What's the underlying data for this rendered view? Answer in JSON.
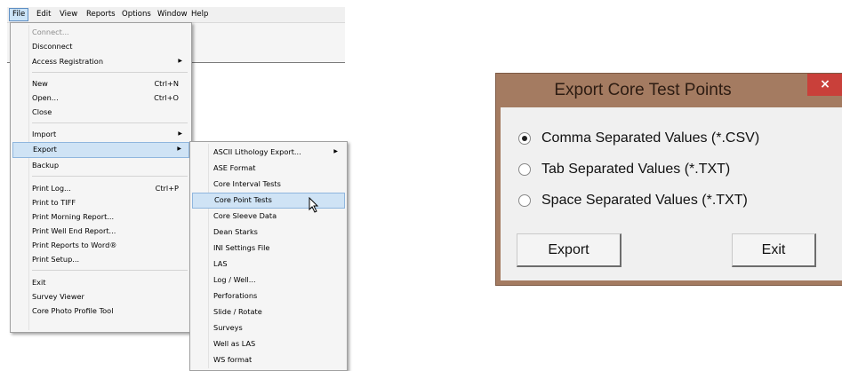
{
  "menubar": {
    "items": [
      "File",
      "Edit",
      "View",
      "Reports",
      "Options",
      "Window",
      "Help"
    ]
  },
  "file_menu": {
    "items": [
      {
        "label": "Connect...",
        "disabled": true
      },
      {
        "label": "Disconnect"
      },
      {
        "label": "Access Registration",
        "submenu": true
      },
      {
        "label": "New",
        "shortcut": "Ctrl+N"
      },
      {
        "label": "Open...",
        "shortcut": "Ctrl+O"
      },
      {
        "label": "Close"
      },
      {
        "label": "Import",
        "submenu": true
      },
      {
        "label": "Export",
        "submenu": true,
        "highlighted": true
      },
      {
        "label": "Backup"
      },
      {
        "label": "Print Log...",
        "shortcut": "Ctrl+P"
      },
      {
        "label": "Print to TIFF"
      },
      {
        "label": "Print Morning Report..."
      },
      {
        "label": "Print Well End Report..."
      },
      {
        "label": "Print Reports to Word®"
      },
      {
        "label": "Print Setup..."
      },
      {
        "label": "Exit"
      },
      {
        "label": "Survey Viewer"
      },
      {
        "label": "Core Photo Profile Tool"
      }
    ]
  },
  "export_menu": {
    "items": [
      {
        "label": "ASCII Lithology Export...",
        "submenu": true
      },
      {
        "label": "ASE Format"
      },
      {
        "label": "Core Interval Tests"
      },
      {
        "label": "Core Point Tests",
        "highlighted": true
      },
      {
        "label": "Core Sleeve Data"
      },
      {
        "label": "Dean Starks"
      },
      {
        "label": "INI Settings File"
      },
      {
        "label": "LAS"
      },
      {
        "label": "Log / Well..."
      },
      {
        "label": "Perforations"
      },
      {
        "label": "Slide / Rotate"
      },
      {
        "label": "Surveys"
      },
      {
        "label": "Well as LAS"
      },
      {
        "label": "WS format"
      }
    ]
  },
  "dialog": {
    "title": "Export Core Test Points",
    "close_glyph": "×",
    "options": [
      {
        "label": "Comma Separated Values (*.CSV)",
        "selected": true
      },
      {
        "label": "Tab Separated Values (*.TXT)",
        "selected": false
      },
      {
        "label": "Space Separated Values (*.TXT)",
        "selected": false
      }
    ],
    "export_label": "Export",
    "exit_label": "Exit"
  },
  "colors": {
    "dialog_titlebar": "#a47b61",
    "close_button": "#c9403a",
    "menu_highlight": "#cfe3f5"
  }
}
